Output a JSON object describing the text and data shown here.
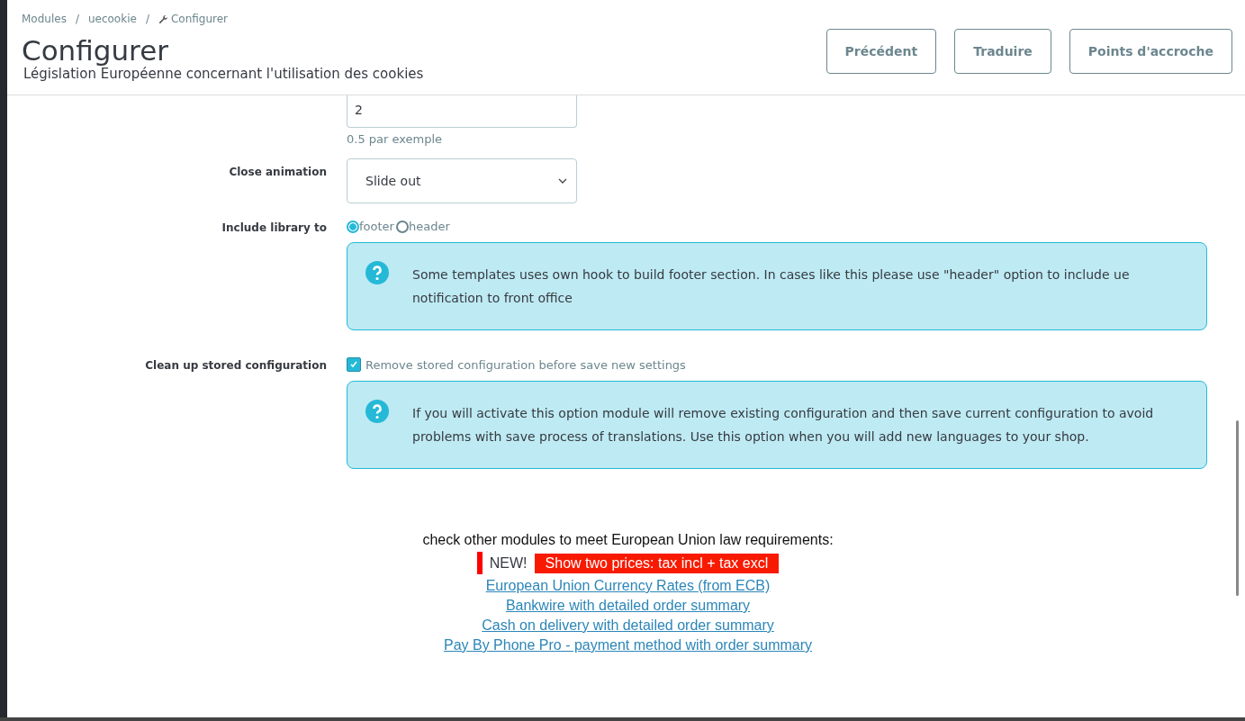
{
  "breadcrumb_separator": "/",
  "breadcrumb": [
    {
      "label": "Modules",
      "icon": false
    },
    {
      "label": "uecookie",
      "icon": false
    },
    {
      "label": "Configurer",
      "icon": true
    }
  ],
  "header": {
    "title": "Configurer",
    "subtitle": "Législation Européenne concernant l'utilisation des cookies",
    "buttons": [
      "Précédent",
      "Traduire",
      "Points d'accroche"
    ]
  },
  "form": [
    {
      "kind": "input",
      "value": "2",
      "help": "0.5 par exemple"
    },
    {
      "kind": "select",
      "label": "Close animation",
      "value": "Slide out"
    },
    {
      "kind": "radio",
      "label": "Include library to",
      "options": [
        {
          "label": "footer",
          "selected": true
        },
        {
          "label": "header",
          "selected": false
        }
      ],
      "info": "Some templates uses own hook to build footer section. In cases like this please use \"header\" option to include ue notification to front office"
    },
    {
      "kind": "checkbox",
      "label": "Clean up stored configuration",
      "checked": true,
      "text": "Remove stored configuration before save new settings",
      "info": "If you will activate this option module will remove existing configuration and then save current configuration to avoid problems with save process of translations. Use this option when you will add new languages to your shop."
    }
  ],
  "promo": {
    "intro": "check other modules to meet European Union law requirements:",
    "badge": "NEW!",
    "highlight": "Show two prices: tax incl + tax excl",
    "links": [
      "European Union Currency Rates (from ECB)",
      "Bankwire with detailed order summary",
      "Cash on delivery with detailed order summary",
      "Pay By Phone Pro - payment method with order summary"
    ]
  }
}
